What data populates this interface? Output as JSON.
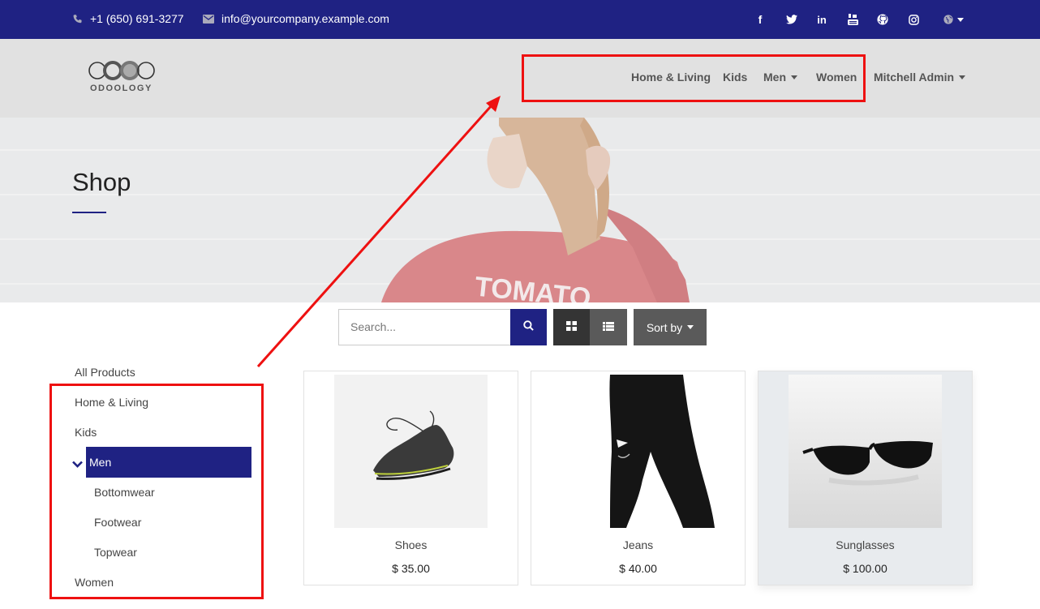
{
  "topbar": {
    "phone": "+1 (650) 691-3277",
    "email": "info@yourcompany.example.com",
    "icons": [
      "phone-icon",
      "envelope-icon",
      "facebook-icon",
      "twitter-icon",
      "linkedin-icon",
      "youtube-icon",
      "github-icon",
      "instagram-icon",
      "globe-icon"
    ]
  },
  "header": {
    "logo_text": "ODOOLOGY",
    "nav": {
      "home_living": "Home & Living",
      "kids": "Kids",
      "men": "Men",
      "women": "Women",
      "user": "Mitchell Admin"
    }
  },
  "hero": {
    "title": "Shop",
    "image_text": "TOMATO"
  },
  "toolbar": {
    "search_placeholder": "Search...",
    "sort_label": "Sort by"
  },
  "sidebar": {
    "all_products": "All Products",
    "home_living": "Home & Living",
    "kids": "Kids",
    "men": "Men",
    "bottomwear": "Bottomwear",
    "footwear": "Footwear",
    "topwear": "Topwear",
    "women": "Women"
  },
  "products": [
    {
      "name": "Shoes",
      "price": "$ 35.00"
    },
    {
      "name": "Jeans",
      "price": "$ 40.00"
    },
    {
      "name": "Sunglasses",
      "price": "$ 100.00"
    }
  ],
  "colors": {
    "brand": "#1f2283",
    "annotation": "#ee1111"
  }
}
